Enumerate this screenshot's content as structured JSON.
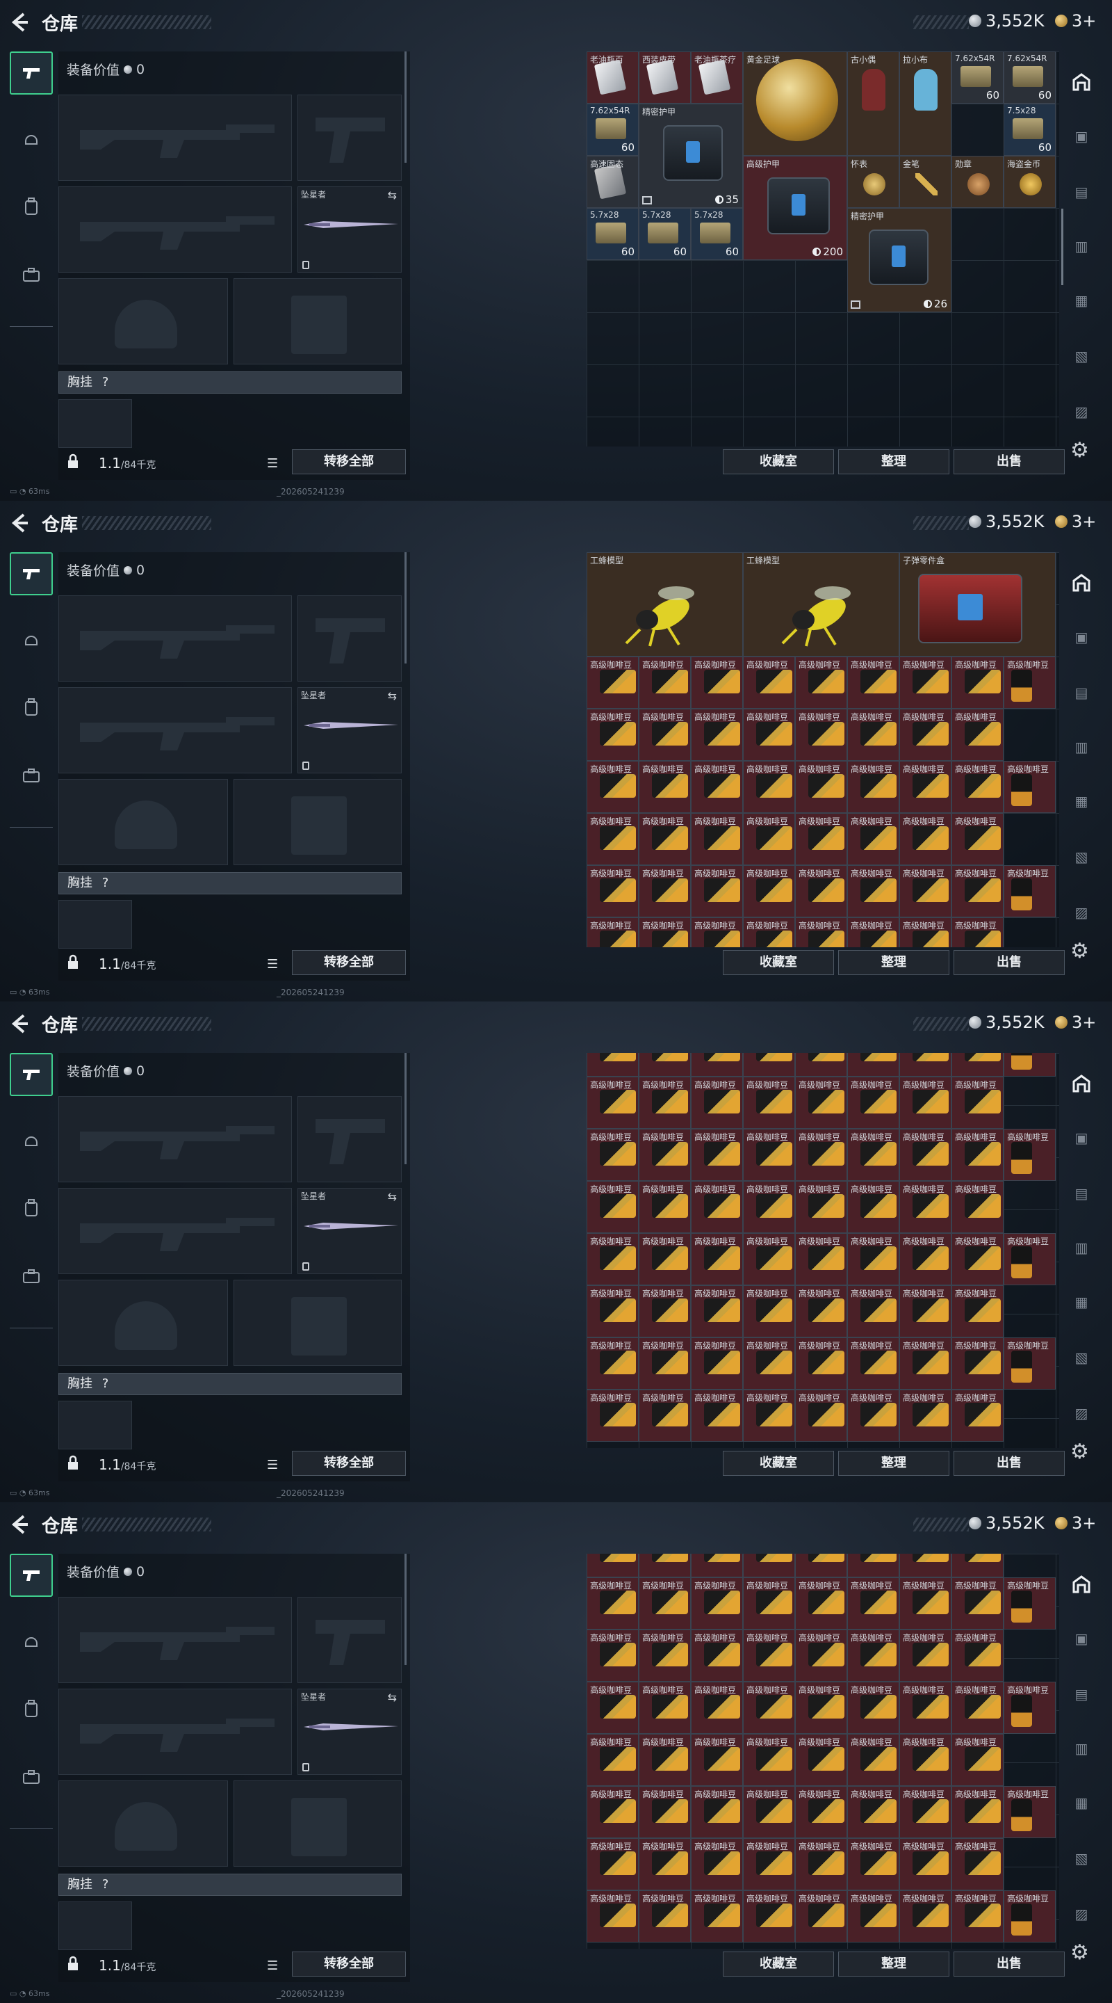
{
  "header": {
    "title": "仓库",
    "silver": "3,552K",
    "gold": "3+"
  },
  "left_panel": {
    "equip_value_label": "装备价值",
    "equip_value": "0",
    "knife_name": "坠星者",
    "chest_label": "胸挂",
    "chest_hint": "?",
    "weight": "1.1",
    "weight_cap": "/84千克",
    "transfer_all": "转移全部"
  },
  "buttons": {
    "collection": "收藏室",
    "sort": "整理",
    "sell": "出售"
  },
  "status": {
    "ping": "63ms",
    "build": "_202605241239"
  },
  "panel1_items": [
    {
      "name": "老油瓶百",
      "count": ""
    },
    {
      "name": "西装皮带",
      "count": ""
    },
    {
      "name": "老油瓶茶疗",
      "count": ""
    },
    {
      "name": "黄金足球",
      "count": ""
    },
    {
      "name": "古小偶",
      "count": ""
    },
    {
      "name": "拉小布",
      "count": ""
    },
    {
      "name": "7.62x54R",
      "count": "60"
    },
    {
      "name": "7.62x54R",
      "count": "60"
    },
    {
      "name": "7.62x54R",
      "count": "60"
    },
    {
      "name": "精密护甲",
      "count": "35"
    },
    {
      "name": "7.5x28",
      "count": "60"
    },
    {
      "name": "高速固态",
      "count": ""
    },
    {
      "name": "高级护甲",
      "count": "200"
    },
    {
      "name": "怀表",
      "count": ""
    },
    {
      "name": "金笔",
      "count": ""
    },
    {
      "name": "勋章",
      "count": ""
    },
    {
      "name": "海盗金币",
      "count": ""
    },
    {
      "name": "5.7x28",
      "count": "60"
    },
    {
      "name": "5.7x28",
      "count": "60"
    },
    {
      "name": "5.7x28",
      "count": "60"
    },
    {
      "name": "精密护甲",
      "count": "26"
    }
  ],
  "panel2_models": [
    {
      "name": "工蜂模型"
    },
    {
      "name": "工蜂模型"
    },
    {
      "name": "子弹零件盒"
    }
  ],
  "coffee_name": "高级咖啡豆"
}
